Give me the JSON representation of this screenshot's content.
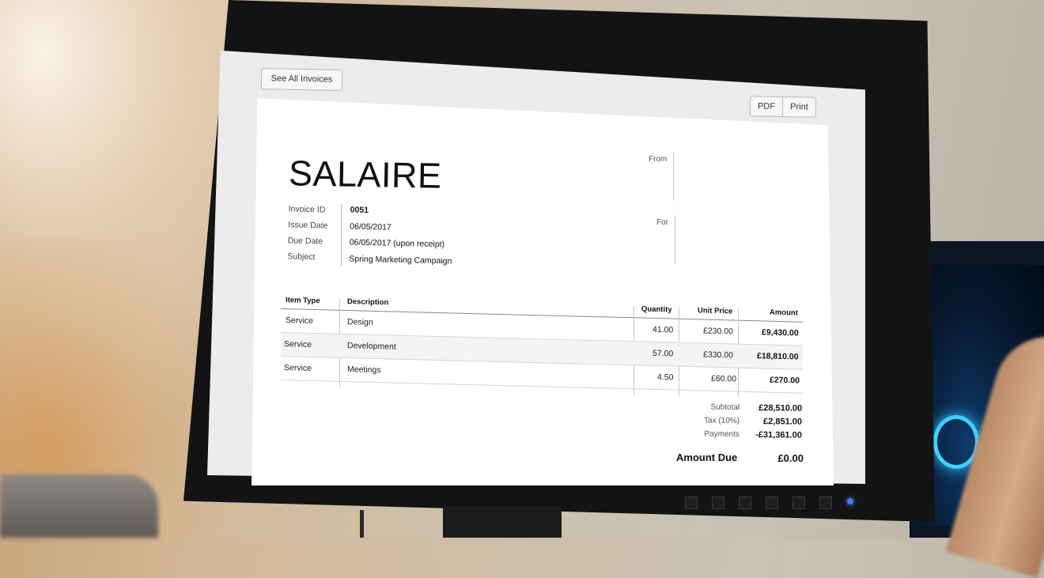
{
  "buttons": {
    "see_all_invoices": "See All Invoices",
    "pdf": "PDF",
    "print": "Print"
  },
  "invoice": {
    "title": "SALAIRE",
    "meta": {
      "labels": [
        "Invoice ID",
        "Issue Date",
        "Due Date",
        "Subject"
      ],
      "values": [
        "0051",
        "06/05/2017",
        "06/05/2017 (upon receipt)",
        "Spring Marketing Campaign"
      ]
    },
    "from_label": "From",
    "for_label": "For",
    "table": {
      "headers": [
        "Item Type",
        "Description",
        "Quantity",
        "Unit Price",
        "Amount"
      ],
      "rows": [
        [
          "Service",
          "Design",
          "41.00",
          "£230.00",
          "£9,430.00"
        ],
        [
          "Service",
          "Development",
          "57.00",
          "£330.00",
          "£18,810.00"
        ],
        [
          "Service",
          "Meetings",
          "4.50",
          "£60.00",
          "£270.00"
        ]
      ]
    },
    "totals": {
      "subtotal_label": "Subtotal",
      "subtotal_value": "£28,510.00",
      "tax_label": "Tax (10%)",
      "tax_value": "£2,851.00",
      "payments_label": "Payments",
      "payments_value": "-£31,361.00",
      "amount_due_label": "Amount Due",
      "amount_due_value": "£0.00"
    }
  }
}
